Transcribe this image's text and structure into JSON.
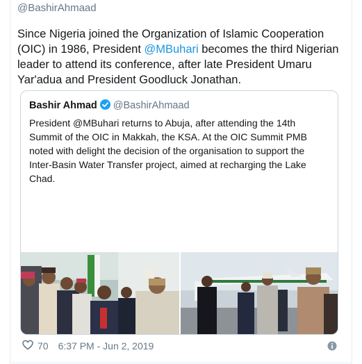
{
  "tweet": {
    "handle": "@BashirAhmaad",
    "text_part1": "Since Nigeria joined the Organization of Islamic Cooperation (OIC) in 1986, President ",
    "mention": "@MBuhari",
    "text_part2": " becomes the third Nigerian leader to attend its conference, after late President Umaru Yar'adua and President Goodluck Jonathan.",
    "likes": "70",
    "timestamp": "6:37 PM - Jun 2, 2019"
  },
  "quoted": {
    "name": "Bashir Ahmad",
    "handle": "@BashirAhmaad",
    "text": "President @MBuhari returns to Abuja, after attending the 14th Summit of the OIC in Makkah, the KSA. At the OIC Summit PMB noted with delight the decision of the organisation to support the Inter-Basin Water Transfer project, aimed at recharging the Lake Chad."
  },
  "icons": {
    "verified": "verified-badge-icon",
    "like": "heart-icon",
    "info": "info-icon"
  },
  "colors": {
    "link": "#1b95e0",
    "verified": "#1da1f2",
    "muted": "#657786",
    "border": "#ccd6dd"
  }
}
